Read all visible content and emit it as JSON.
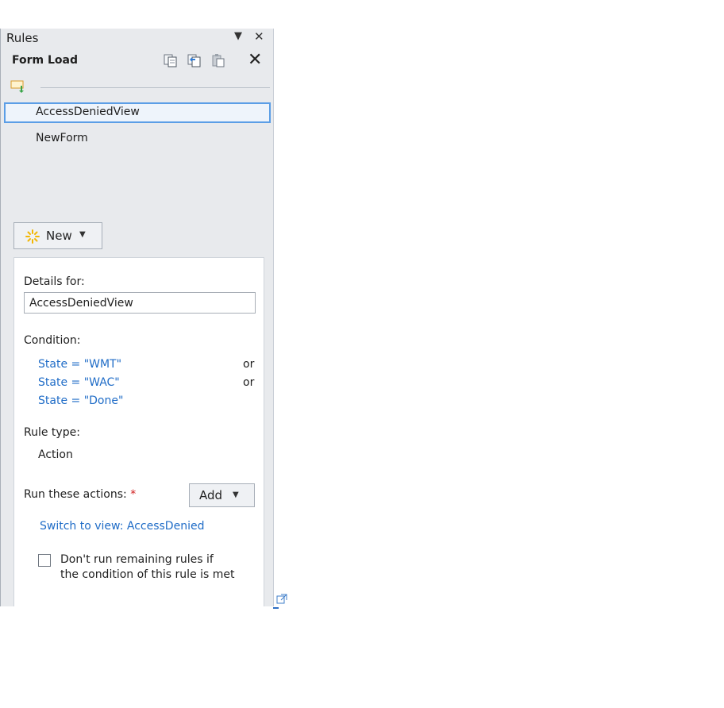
{
  "pane": {
    "title": "Rules",
    "menu_icon": "dropdown-triangle-icon",
    "close_icon": "close-icon"
  },
  "toolbar": {
    "section_name": "Form Load",
    "buttons": [
      "copy-icon",
      "copy-rule-icon",
      "paste-icon",
      "delete-icon"
    ],
    "delete_glyph": "✕"
  },
  "rules": {
    "header_icon": "rule-group-icon",
    "items": [
      {
        "label": "AccessDeniedView",
        "selected": true
      },
      {
        "label": "NewForm",
        "selected": false
      }
    ]
  },
  "new_button": {
    "label": "New",
    "icon": "sparkle-icon",
    "arrow": "▼"
  },
  "details": {
    "details_for_label": "Details for:",
    "rule_name_value": "AccessDeniedView",
    "condition_label": "Condition:",
    "conditions": [
      {
        "text": "State = \"WMT\"",
        "joiner": "or"
      },
      {
        "text": "State = \"WAC\"",
        "joiner": "or"
      },
      {
        "text": "State = \"Done\"",
        "joiner": ""
      }
    ],
    "rule_type_label": "Rule type:",
    "rule_type_value": "Action",
    "run_actions_label": "Run these actions:",
    "required_mark": "*",
    "add_button_label": "Add",
    "add_button_arrow": "▼",
    "action_link": "Switch to view: AccessDenied",
    "checkbox_line1": "Don't run remaining rules if",
    "checkbox_line2": "the condition of this rule is met",
    "checkbox_checked": false
  },
  "colors": {
    "pane_bg": "#e8eaed",
    "link": "#1f6cc7",
    "selection_border": "#5b9ee6",
    "required": "#d01c1c"
  }
}
